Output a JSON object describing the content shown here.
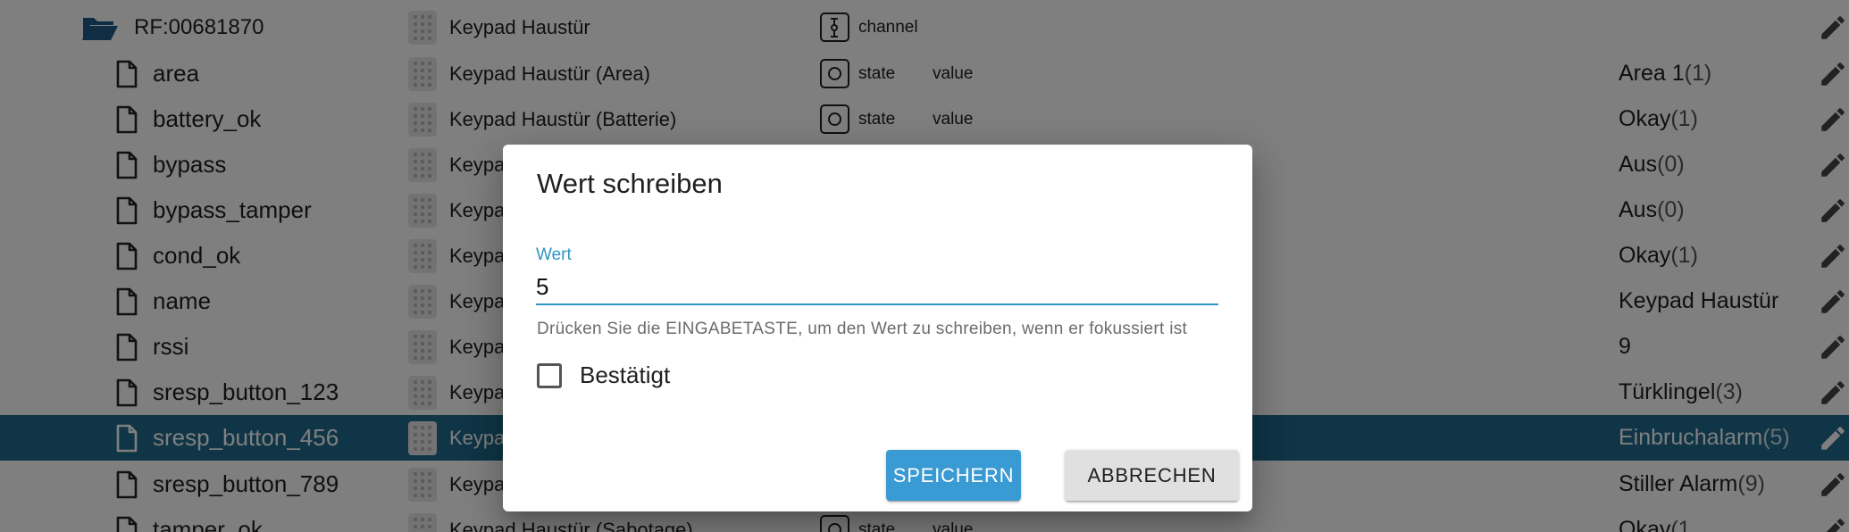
{
  "table": {
    "channel": {
      "name": "RF:00681870",
      "description": "Keypad Haustür",
      "type_label": "channel",
      "icon": "folder-open-icon"
    },
    "rows": [
      {
        "name": "area",
        "description": "Keypad Haustür (Area)",
        "role": "state",
        "sub": "value",
        "value_text": "Area 1",
        "value_num": "(1)"
      },
      {
        "name": "battery_ok",
        "description": "Keypad Haustür (Batterie)",
        "role": "state",
        "sub": "value",
        "value_text": "Okay",
        "value_num": "(1)"
      },
      {
        "name": "bypass",
        "description": "Keypa",
        "role": "",
        "sub": "",
        "value_text": "Aus",
        "value_num": "(0)"
      },
      {
        "name": "bypass_tamper",
        "description": "Keypa",
        "role": "",
        "sub": "",
        "value_text": "Aus",
        "value_num": "(0)"
      },
      {
        "name": "cond_ok",
        "description": "Keypa",
        "role": "",
        "sub": "",
        "value_text": "Okay",
        "value_num": "(1)"
      },
      {
        "name": "name",
        "description": "Keypa",
        "role": "",
        "sub": "",
        "value_text": "Keypad Haustür",
        "value_num": ""
      },
      {
        "name": "rssi",
        "description": "Keypa",
        "role": "",
        "sub": "",
        "value_text": "9",
        "value_num": ""
      },
      {
        "name": "sresp_button_123",
        "description": "Keypa",
        "role": "",
        "sub": "",
        "value_text": "Türklingel",
        "value_num": "(3)"
      },
      {
        "name": "sresp_button_456",
        "description": "Keypa",
        "role": "",
        "sub": "",
        "value_text": "Einbruchalarm",
        "value_num": "(5)",
        "selected": true
      },
      {
        "name": "sresp_button_789",
        "description": "Keypa",
        "role": "",
        "sub": "",
        "value_text": "Stiller Alarm",
        "value_num": "(9)"
      },
      {
        "name": "tamper_ok",
        "description": "Keypad Haustür (Sabotage)",
        "role": "state",
        "sub": "value",
        "value_text": "Okay",
        "value_num": "(1"
      }
    ]
  },
  "dialog": {
    "title": "Wert schreiben",
    "field_label": "Wert",
    "field_value": "5",
    "helper": "Drücken Sie die EINGABETASTE, um den Wert zu schreiben, wenn er fokussiert ist",
    "checkbox_label": "Bestätigt",
    "checkbox_checked": false,
    "save_label": "SPEICHERN",
    "cancel_label": "ABBRECHEN"
  },
  "colors": {
    "selected_row": "#1e6b8c",
    "accent": "#2f95c4",
    "primary_button": "#3a9ad3",
    "folder": "#1e5a86"
  }
}
